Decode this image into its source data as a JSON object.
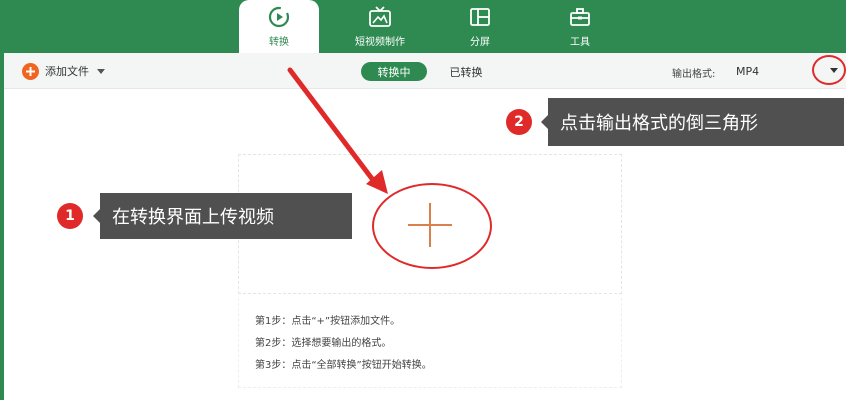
{
  "nav": {
    "tabs": [
      {
        "label": "转换",
        "icon": "convert-icon",
        "active": true
      },
      {
        "label": "短视频制作",
        "icon": "tv-icon",
        "active": false
      },
      {
        "label": "分屏",
        "icon": "split-screen-icon",
        "active": false
      },
      {
        "label": "工具",
        "icon": "toolbox-icon",
        "active": false
      }
    ]
  },
  "toolbar": {
    "add_file_label": "添加文件",
    "converting_label": "转换中",
    "converted_label": "已转换",
    "output_format_label": "输出格式:",
    "output_format_value": "MP4"
  },
  "dropzone": {
    "steps": [
      "第1步：点击“+”按钮添加文件。",
      "第2步：选择想要输出的格式。",
      "第3步：点击“全部转换”按钮开始转换。"
    ]
  },
  "annotations": [
    {
      "number": "1",
      "text": "在转换界面上传视频"
    },
    {
      "number": "2",
      "text": "点击输出格式的倒三角形"
    }
  ],
  "colors": {
    "brand_green": "#2f8a52",
    "accent_orange": "#f0651f",
    "annotation_red": "#e02a2a",
    "callout_gray": "#505050"
  }
}
